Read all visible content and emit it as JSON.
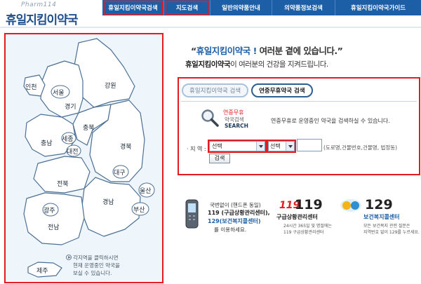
{
  "logo": {
    "sub": "Pharm114",
    "main": "휴일지킴이약국"
  },
  "gnb": [
    {
      "label": "휴일지킴이약국검색",
      "highlighted": true
    },
    {
      "label": "지도검색",
      "highlighted": true
    },
    {
      "label": "일반의약품안내",
      "highlighted": false
    },
    {
      "label": "의약품정보검색",
      "highlighted": false
    },
    {
      "label": "휴일지킴이약국가이드",
      "highlighted": false
    }
  ],
  "map": {
    "regions": {
      "incheon": "인천",
      "seoul": "서울",
      "gangwon": "강원",
      "gyeonggi": "경기",
      "chungbuk": "충북",
      "chungnam": "충남",
      "sejong": "세종",
      "daejeon": "대전",
      "gyeongbuk": "경북",
      "jeonbuk": "전북",
      "daegu": "대구",
      "ulsan": "울산",
      "gyeongnam": "경남",
      "busan": "부산",
      "gwangju": "광주",
      "jeonnam": "전남",
      "jeju": "제주"
    },
    "hint_lines": [
      "각지역을 클릭하시면",
      "현재 운영중인 약국을",
      "보실 수 있습니다."
    ]
  },
  "slogan": {
    "line1_quote_open": "“",
    "line1_brand": "휴일지킴이약국 !",
    "line1_rest": " 여러분 곁에 있습니다.”",
    "line2_brand": "휴일지킴이약국",
    "line2_rest": "이 여러분의 건강을 지켜드립니다."
  },
  "search": {
    "tabs": [
      {
        "label": "휴일지킴이약국 검색",
        "active": false
      },
      {
        "label": "연중무휴약국 검색",
        "active": true
      }
    ],
    "icon_line1": "연중무휴",
    "icon_line2": "약국검색",
    "icon_line3": "SEARCH",
    "description": "연중무휴로 운영중인 약국을 검색하실 수 있습니다.",
    "addr_label": "· 지 역 :",
    "select1": "선택",
    "select2": "선택",
    "addr_hint": "(도로명,건물번호,건물명, 법정동)",
    "button": "검색"
  },
  "info": {
    "line1": "국번없이 (핸드폰 동일)",
    "line2": "119 (구급상황관리센터),",
    "line3": "129(보건복지콜센터)",
    "line4": "를 이용하세요.",
    "logo119": "119",
    "num119": "119",
    "title119": "구급상황관리센터",
    "desc119_1": "24시간 365일 및 명절에는",
    "desc119_2": "119 구급상황관리센터",
    "num129": "129",
    "title129": "보건복지콜센터",
    "desc129_1": "모든 보건복지 관련 질문은",
    "desc129_2": "지역번호 없이 129를 누르세요."
  },
  "colors": {
    "nav": "#1d5fa6",
    "highlight": "#e51b23",
    "border": "#2d5f8f"
  }
}
